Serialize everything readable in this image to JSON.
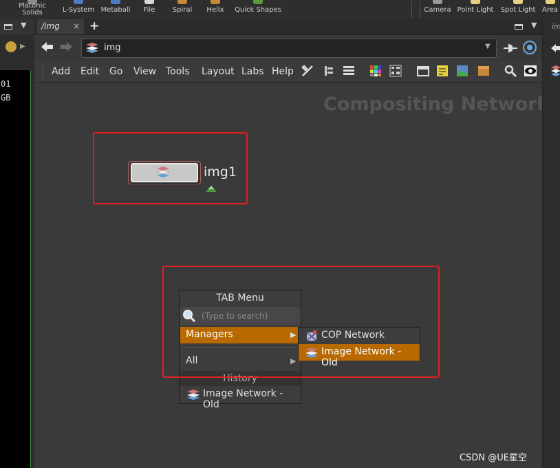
{
  "shelf": {
    "tools": [
      {
        "name": "platonic-solids",
        "label": "Platonic\nSolids"
      },
      {
        "name": "l-system",
        "label": "L-System"
      },
      {
        "name": "metaball",
        "label": "Metaball"
      },
      {
        "name": "file",
        "label": "File"
      },
      {
        "name": "spiral",
        "label": "Spiral"
      },
      {
        "name": "helix",
        "label": "Helix"
      },
      {
        "name": "quick-shapes",
        "label": "Quick Shapes"
      },
      {
        "name": "camera",
        "label": "Camera"
      },
      {
        "name": "point-light",
        "label": "Point Light"
      },
      {
        "name": "spot-light",
        "label": "Spot Light"
      },
      {
        "name": "area-light",
        "label": "Area L"
      }
    ]
  },
  "console": {
    "line1": "01",
    "line2": "GB"
  },
  "tabs": {
    "active_label": "/img",
    "close_glyph": "×",
    "add_glyph": "+",
    "right_tab_label": "im"
  },
  "path": {
    "value": "img"
  },
  "menubar": {
    "items": [
      "Add",
      "Edit",
      "Go",
      "View",
      "Tools",
      "Layout",
      "Labs",
      "Help"
    ]
  },
  "network": {
    "title": "Compositing Networks",
    "node": {
      "name": "img1"
    }
  },
  "tab_menu": {
    "title": "TAB Menu",
    "search_placeholder": "(Type to search)",
    "managers_label": "Managers",
    "all_label": "All",
    "history_label": "History",
    "history_item": "Image Network - Old",
    "submenu": {
      "items": [
        "COP Network",
        "Image Network - Old"
      ],
      "selected_index": 1
    },
    "arrow_glyph": "▶"
  },
  "watermark": "CSDN @UE星空",
  "colors": {
    "highlight": "#b86a00",
    "annotation_red": "#e02020",
    "network_bg": "#3a3a3a",
    "title_text": "#555555"
  }
}
